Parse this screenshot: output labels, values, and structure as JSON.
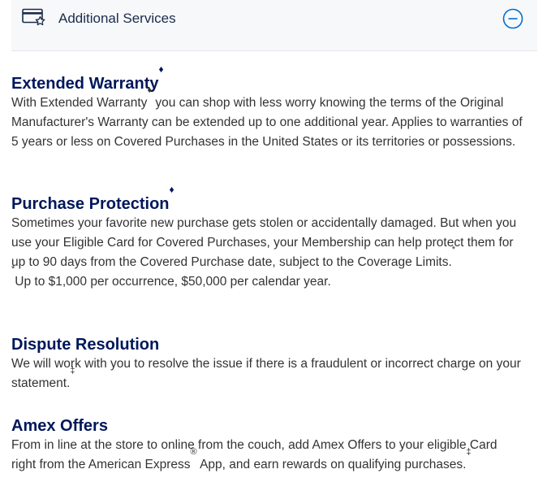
{
  "header": {
    "title": "Additional Services"
  },
  "sections": [
    {
      "title": "Extended Warranty",
      "title_mark": "♦",
      "body_1": "With Extended Warranty",
      "body_mark": "♦",
      "body_2": " you can shop with less worry knowing the terms of the Original Manufacturer's Warranty can be extended up to one additional year. Applies to warranties of 5 years or less on Covered Purchases in the United States or its territories or possessions."
    },
    {
      "title": "Purchase Protection",
      "title_mark": "♦",
      "body": "Sometimes your favorite new purchase gets stolen or accidentally damaged. But when you use your Eligible Card for Covered Purchases, your Membership can help protect them for up to 90 days from the Covered Purchase date, subject to the Coverage Limits.",
      "body_mark": "*",
      "footnote_mark": "*",
      "footnote": "Up to $1,000 per occurrence, $50,000 per calendar year."
    },
    {
      "title": "Dispute Resolution",
      "body": "We will work with you to resolve the issue if there is a fraudulent or incorrect charge on your statement.",
      "body_mark": "‡"
    },
    {
      "title": "Amex Offers",
      "body_1": "From in line at the store to online from the couch, add Amex Offers to your eligible Card right from the American Express",
      "registered_mark": "®",
      "body_2": " App, and earn rewards on qualifying purchases.",
      "body_mark": "‡"
    }
  ],
  "icons": {
    "card": "card-star-icon",
    "collapse": "minus-circle-icon"
  },
  "colors": {
    "heading": "#00175a",
    "accent": "#006fcf",
    "text": "#333333",
    "header_bg": "#f7f8f9"
  }
}
